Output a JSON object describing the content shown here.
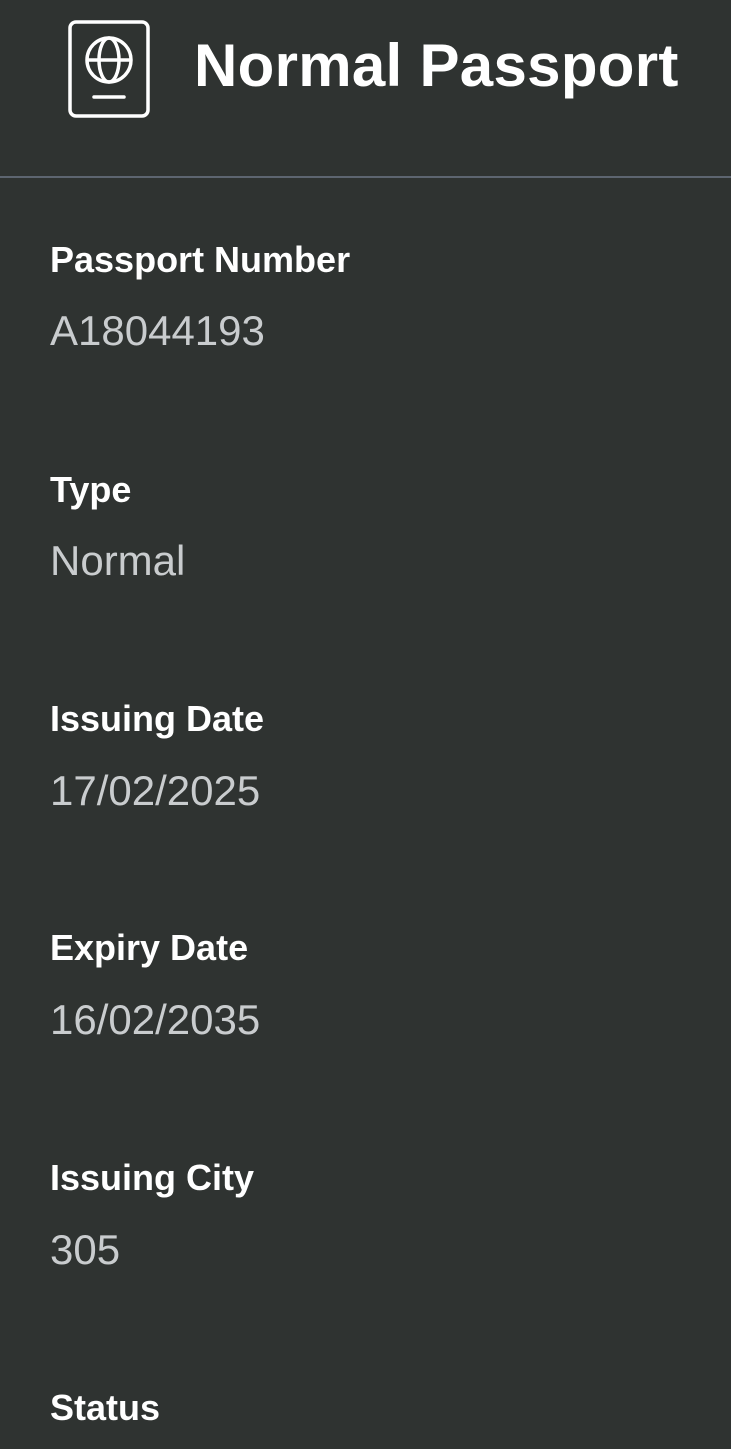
{
  "header": {
    "icon": "passport-icon",
    "title": "Normal Passport"
  },
  "fields": [
    {
      "label": "Passport Number",
      "value": "A18044193"
    },
    {
      "label": "Type",
      "value": "Normal"
    },
    {
      "label": "Issuing Date",
      "value": "17/02/2025"
    },
    {
      "label": "Expiry Date",
      "value": "16/02/2035"
    },
    {
      "label": "Issuing City",
      "value": "305"
    },
    {
      "label": "Status",
      "value": ""
    }
  ]
}
